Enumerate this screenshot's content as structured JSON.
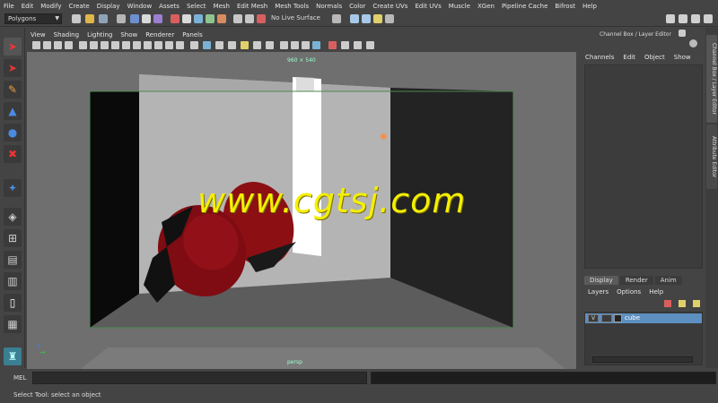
{
  "menu": [
    "File",
    "Edit",
    "Modify",
    "Create",
    "Display",
    "Window",
    "Assets",
    "Select",
    "Mesh",
    "Edit Mesh",
    "Mesh Tools",
    "Normals",
    "Color",
    "Create UVs",
    "Edit UVs",
    "Muscle",
    "XGen",
    "Pipeline Cache",
    "Bifrost",
    "Help"
  ],
  "status_line": {
    "mode": "Polygons",
    "live_surface": "No Live Surface"
  },
  "viewport": {
    "menu": [
      "View",
      "Shading",
      "Lighting",
      "Show",
      "Renderer",
      "Panels"
    ],
    "resolution": "960 × 540",
    "camera": "persp",
    "watermark": "www.cgtsj.com"
  },
  "channel_box": {
    "title": "Channel Box / Layer Editor",
    "tabs": [
      "Channels",
      "Edit",
      "Object",
      "Show"
    ],
    "side_tabs": [
      "Channel Box / Layer Editor",
      "Attribute Editor"
    ]
  },
  "layer_editor": {
    "tabs": [
      "Display",
      "Render",
      "Anim"
    ],
    "active_tab": "Display",
    "menu": [
      "Layers",
      "Options",
      "Help"
    ],
    "layers": [
      {
        "visible": "V",
        "name": "cube"
      }
    ]
  },
  "command_line": {
    "label": "MEL"
  },
  "help_line": {
    "text": "Select Tool: select an object"
  },
  "colors": {
    "ui_bg": "#444444",
    "selected_layer": "#5d8fc0",
    "watermark": "#f5f000",
    "strawberry": "#8c0f14"
  },
  "icons": [
    "select-arrow-icon",
    "lasso-icon",
    "paint-select-icon",
    "move-icon",
    "rotate-icon",
    "scale-icon",
    "render-icon",
    "grid-icon"
  ]
}
